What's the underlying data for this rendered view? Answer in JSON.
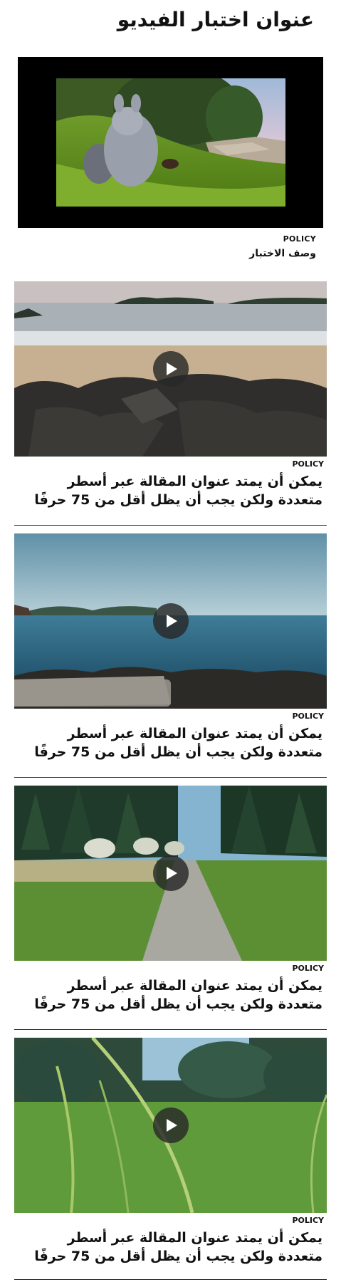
{
  "page": {
    "title": "عنوان اختبار الفيديو"
  },
  "featured_video": {
    "label": "POLICY",
    "description": "وصف الاختبار"
  },
  "articles": [
    {
      "label": "POLICY",
      "title": "يمكن أن يمتد عنوان المقالة عبر أسطر متعددة ولكن يجب أن يظل أقل من 75 حرفًا",
      "thumbnail": "beach-rocks"
    },
    {
      "label": "POLICY",
      "title": "يمكن أن يمتد عنوان المقالة عبر أسطر متعددة ولكن يجب أن يظل أقل من 75 حرفًا",
      "thumbnail": "lake-shore"
    },
    {
      "label": "POLICY",
      "title": "يمكن أن يمتد عنوان المقالة عبر أسطر متعددة ولكن يجب أن يظل أقل من 75 حرفًا",
      "thumbnail": "forest-path"
    },
    {
      "label": "POLICY",
      "title": "يمكن أن يمتد عنوان المقالة عبر أسطر متعددة ولكن يجب أن يظل أقل من 75 حرفًا",
      "thumbnail": "grass-field"
    }
  ],
  "icons": {
    "play": "play-icon"
  }
}
